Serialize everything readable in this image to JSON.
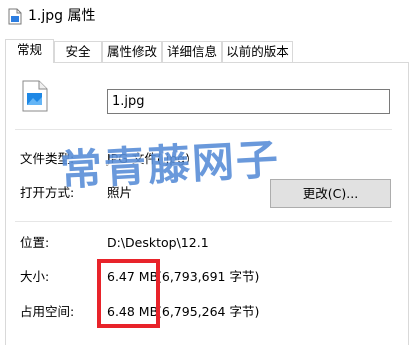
{
  "window": {
    "title": "1.jpg 属性"
  },
  "tabs": [
    {
      "label": "常规"
    },
    {
      "label": "安全"
    },
    {
      "label": "属性修改"
    },
    {
      "label": "详细信息"
    },
    {
      "label": "以前的版本"
    }
  ],
  "general": {
    "file_name": "1.jpg",
    "file_type_label": "文件类型:",
    "file_type_value": "JPG 文件(.jpg)",
    "open_with_label": "打开方式:",
    "open_with_value": "照片",
    "change_button": "更改(C)...",
    "location_label": "位置:",
    "location_value": "D:\\Desktop\\12.1",
    "size_label": "大小:",
    "size_value": "6.47 MB",
    "size_bytes": "(6,793,691 字节)",
    "disk_size_label": "占用空间:",
    "disk_size_value": "6.48 MB",
    "disk_size_bytes": "(6,795,264 字节)"
  },
  "watermark": "常青藤网子",
  "colors": {
    "highlight_box": "#e8232a",
    "watermark": "#5a8fd8"
  }
}
